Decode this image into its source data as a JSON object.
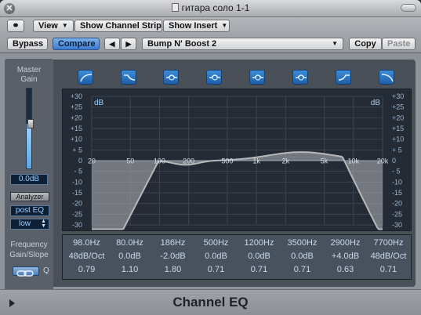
{
  "window": {
    "title": "гитара соло 1-1"
  },
  "toolbar": {
    "view_label": "View",
    "channel_strip_label": "Show Channel Strip",
    "insert_label": "Show Insert",
    "bypass_label": "Bypass",
    "compare_label": "Compare",
    "prev_label": "◀",
    "next_label": "▶",
    "preset_value": "Bump N' Boost 2",
    "copy_label": "Copy",
    "paste_label": "Paste"
  },
  "left_panel": {
    "master_label": "Master",
    "gain_label": "Gain",
    "gain_value": "0.0dB",
    "gain_level_fraction": 0.56,
    "analyzer_label": "Analyzer",
    "analyzer_mode": "post EQ",
    "resolution": "low"
  },
  "band_icons": [
    "high-pass-icon",
    "low-shelf-icon",
    "bell-icon",
    "bell-icon",
    "bell-icon",
    "bell-icon",
    "high-shelf-icon",
    "low-pass-icon"
  ],
  "graph": {
    "db_label": "dB",
    "y_ticks": [
      "+30",
      "+25",
      "+20",
      "+15",
      "+10",
      "+ 5",
      "0",
      "- 5",
      "-10",
      "-15",
      "-20",
      "-25",
      "-30"
    ],
    "x_ticks": [
      "20",
      "50",
      "100",
      "200",
      "500",
      "1k",
      "2k",
      "5k",
      "10k",
      "20k"
    ],
    "curve_color": "#b6b8bb"
  },
  "params": {
    "row_labels": [
      "Frequency",
      "Gain/Slope",
      "Q"
    ],
    "frequency": [
      "98.0Hz",
      "80.0Hz",
      "186Hz",
      "500Hz",
      "1200Hz",
      "3500Hz",
      "2900Hz",
      "7700Hz"
    ],
    "gain": [
      "48dB/Oct",
      "0.0dB",
      "-2.0dB",
      "0.0dB",
      "0.0dB",
      "0.0dB",
      "+4.0dB",
      "48dB/Oct"
    ],
    "q": [
      "0.79",
      "1.10",
      "1.80",
      "0.71",
      "0.71",
      "0.71",
      "0.63",
      "0.71"
    ]
  },
  "footer": {
    "title": "Channel EQ"
  }
}
